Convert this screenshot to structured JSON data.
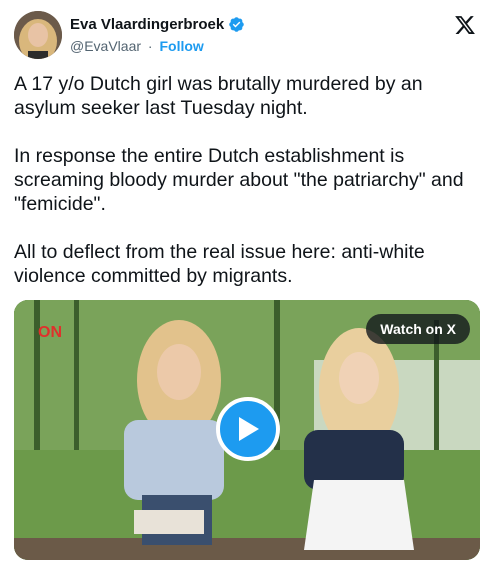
{
  "author": {
    "name": "Eva Vlaardingerbroek",
    "handle": "@EvaVlaar",
    "separator": "·",
    "follow_label": "Follow",
    "verified": true
  },
  "platform_icon": "x-logo-icon",
  "tweet": {
    "paragraphs": [
      "A 17 y/o Dutch girl was brutally murdered by an asylum seeker last Tuesday night.",
      "In response the entire Dutch establishment is screaming bloody murder about \"the patriarchy\" and \"femicide\".",
      "All to deflect from the real issue here: anti-white violence committed by migrants."
    ]
  },
  "media": {
    "watch_label": "Watch on X",
    "play_icon": "play-icon",
    "channel_logo": "ON",
    "colors": {
      "accent": "#1d9bf0",
      "pill_bg": "#0f1419"
    }
  }
}
